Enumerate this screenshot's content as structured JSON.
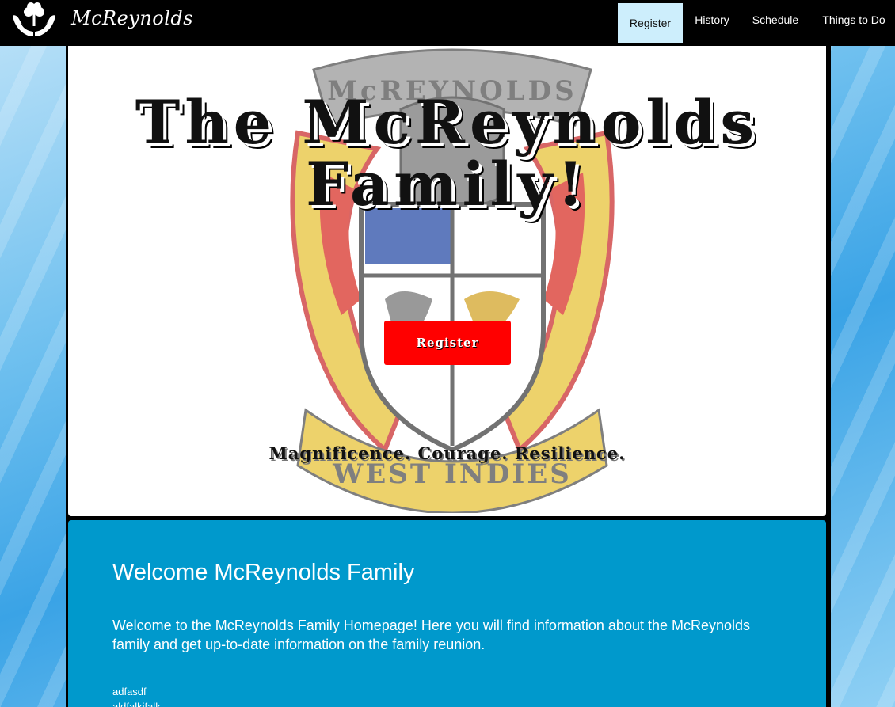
{
  "navbar": {
    "brand": "McReynolds",
    "items": [
      {
        "label": "Register",
        "active": true
      },
      {
        "label": "History"
      },
      {
        "label": "Schedule"
      },
      {
        "label": "Things to Do"
      }
    ]
  },
  "hero": {
    "title": "The McReynolds Family!",
    "button_label": "Register",
    "tagline": "Magnificence. Courage. Resilience.",
    "crest_text_top": "McREYNOLDS",
    "crest_text_bottom": "WEST INDIES"
  },
  "welcome": {
    "heading": "Welcome McReynolds Family",
    "intro": "Welcome to the McReynolds Family Homepage! Here you will find information about the McReynolds family and get up-to-date information on the family reunion.",
    "lines": [
      "adfasdf",
      "aldfalkjfalk"
    ]
  },
  "colors": {
    "nav_background": "#000000",
    "nav_active": "#cdeefc",
    "button_red": "#ff0000",
    "welcome_blue": "#0099cc"
  }
}
